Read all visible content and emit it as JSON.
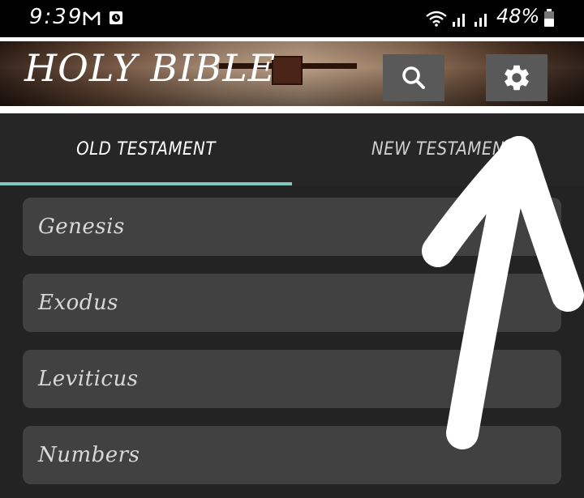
{
  "status_bar": {
    "time": "9:39",
    "battery": "48%",
    "icons": [
      "gmail-icon",
      "clock-icon",
      "wifi-icon",
      "signal-icon",
      "signal-icon",
      "battery-icon"
    ]
  },
  "header": {
    "title": "HOLY BIBLE",
    "search_icon": "search-icon",
    "settings_icon": "gear-icon"
  },
  "tabs": [
    {
      "label": "OLD TESTAMENT",
      "selected": true
    },
    {
      "label": "NEW TESTAMEN",
      "selected": false
    }
  ],
  "books": [
    {
      "label": "Genesis"
    },
    {
      "label": "Exodus"
    },
    {
      "label": "Leviticus"
    },
    {
      "label": "Numbers"
    }
  ],
  "colors": {
    "tab_indicator": "#7fc9c0",
    "background": "#232323",
    "item_background": "#414141",
    "button_background": "#595959"
  }
}
